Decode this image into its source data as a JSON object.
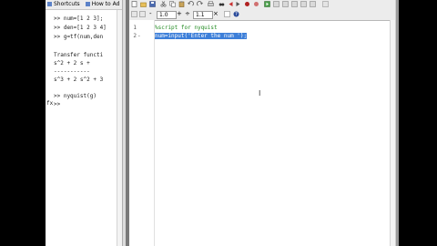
{
  "command_window": {
    "shortcuts_bar": {
      "shortcuts_label": "Shortcuts",
      "howto_label": "How to Ad"
    },
    "lines": [
      {
        "text": ">> num=[1 2 3];"
      },
      {
        "text": ">> den=[1 2 3 4]"
      },
      {
        "text": ">> g=tf(num,den"
      },
      {
        "text": ""
      },
      {
        "text": "Transfer functi"
      },
      {
        "text": "    s^2 + 2 s +"
      },
      {
        "text": "   -----------"
      },
      {
        "text": "s^3 + 2 s^2 + 3"
      },
      {
        "text": ""
      },
      {
        "text": ">> nyquist(g)"
      },
      {
        "text": ">>"
      }
    ],
    "prompt_indicator": "fx"
  },
  "editor": {
    "cell_toolbar": {
      "value1": "1.0",
      "value2": "1.1",
      "minus_label": "-",
      "plus_label": "+",
      "divide_label": "÷",
      "times_label": "×"
    },
    "line_numbers": [
      "1",
      "2"
    ],
    "line_markers": [
      "",
      "-"
    ],
    "code": [
      {
        "text": "%script for nyquist",
        "style": "comment"
      },
      {
        "text": "num=input('Enter the num ');",
        "style": "selected"
      }
    ]
  },
  "icons": {
    "new": "new-file-icon",
    "open": "open-file-icon",
    "save": "save-icon",
    "cut": "cut-icon",
    "copy": "copy-icon",
    "paste": "paste-icon",
    "undo": "undo-icon",
    "redo": "redo-icon",
    "print": "print-icon",
    "find": "find-icon",
    "back": "back-icon",
    "forward": "forward-icon",
    "breakpoint": "breakpoint-icon",
    "run": "run-icon",
    "help": "help-icon"
  },
  "colors": {
    "comment": "#228b22",
    "selection": "#3d7fd9",
    "toolbar": "#ececec"
  }
}
